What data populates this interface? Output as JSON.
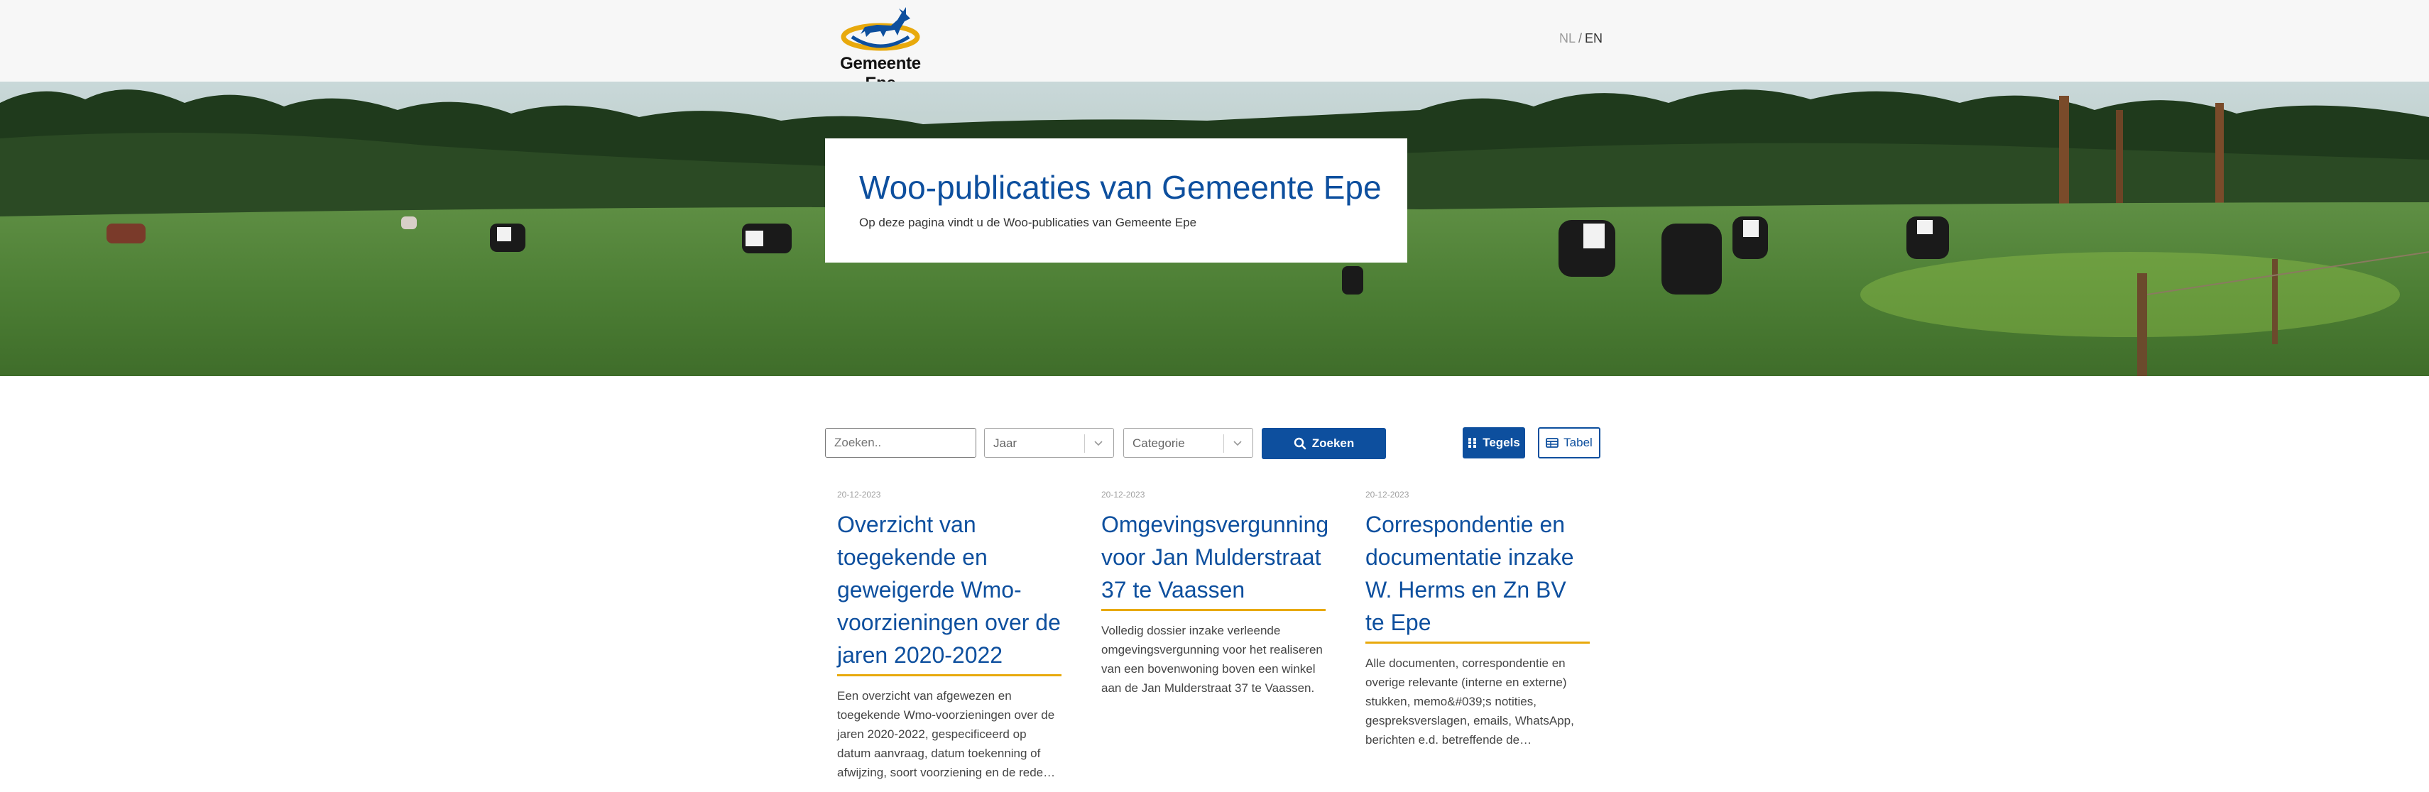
{
  "header": {
    "logo_text": "Gemeente Epe",
    "lang_nl": "NL",
    "lang_sep": "/",
    "lang_en": "EN"
  },
  "hero": {
    "title": "Woo-publicaties van Gemeente Epe",
    "subtitle": "Op deze pagina vindt u de Woo-publicaties van Gemeente Epe"
  },
  "filters": {
    "search_placeholder": "Zoeken..",
    "year_value": "Jaar",
    "category_value": "Categorie",
    "search_button": "Zoeken",
    "tiles_button": "Tegels",
    "table_button": "Tabel"
  },
  "cards": [
    {
      "date": "20-12-2023",
      "title": "Overzicht van toegekende en geweigerde Wmo-voorzieningen over de jaren 2020-2022",
      "description": "Een overzicht van afgewezen en toegekende Wmo-voorzieningen over de jaren 2020-2022, gespecificeerd op datum aanvraag, datum toekenning of afwijzing, soort voorziening en de rede…"
    },
    {
      "date": "20-12-2023",
      "title": "Omgevingsvergunning voor Jan Mulderstraat 37 te Vaassen",
      "description": "Volledig dossier inzake verleende omgevingsvergunning voor het realiseren van een bovenwoning boven een winkel aan de Jan Mulderstraat 37 te Vaassen."
    },
    {
      "date": "20-12-2023",
      "title": "Correspondentie en documentatie inzake W. Herms en Zn BV te Epe",
      "description": "Alle documenten, correspondentie en overige relevante (interne en externe) stukken, memo&#039;s notities, gespreksverslagen, emails, WhatsApp, berichten e.d. betreffende de…"
    }
  ],
  "colors": {
    "brand_blue": "#0d4f9e",
    "accent_gold": "#e8a90c"
  }
}
